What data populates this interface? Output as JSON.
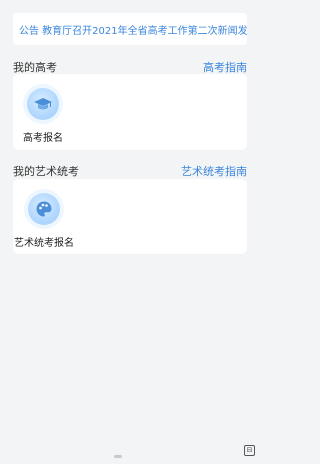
{
  "notice": {
    "text": "公告  教育厅召开2021年全省高考工作第二次新闻发"
  },
  "sections": [
    {
      "title": "我的高考",
      "link": "高考指南",
      "items": [
        {
          "label": "高考报名",
          "icon": "graduation-cap-icon"
        }
      ]
    },
    {
      "title": "我的艺术统考",
      "link": "艺术统考指南",
      "items": [
        {
          "label": "艺术统考报名",
          "icon": "palette-icon"
        }
      ]
    }
  ],
  "corner_button": {
    "icon": "expand-icon",
    "glyph": "⊟"
  },
  "colors": {
    "accent": "#3a86dc",
    "icon_bg": "#b4d9ff",
    "page_bg": "#f3f4f6"
  }
}
